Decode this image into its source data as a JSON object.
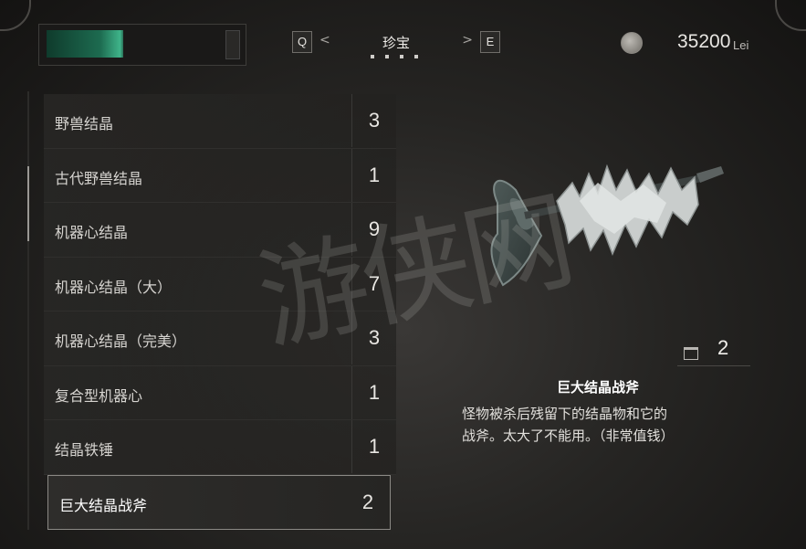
{
  "hud": {
    "health_fraction": 0.4
  },
  "nav": {
    "prev_key": "Q",
    "next_key": "E",
    "tab_label": "珍宝",
    "tab_page_count": 4
  },
  "currency": {
    "amount": "35200",
    "unit": "Lei"
  },
  "items": [
    {
      "name": "野兽结晶",
      "count": "3"
    },
    {
      "name": "古代野兽结晶",
      "count": "1"
    },
    {
      "name": "机器心结晶",
      "count": "9"
    },
    {
      "name": "机器心结晶（大）",
      "count": "7"
    },
    {
      "name": "机器心结晶（完美）",
      "count": "3"
    },
    {
      "name": "复合型机器心",
      "count": "1"
    },
    {
      "name": "结晶铁锤",
      "count": "1"
    },
    {
      "name": "巨大结晶战斧",
      "count": "2"
    }
  ],
  "selected_index": 7,
  "detail": {
    "owned_count": "2",
    "name": "巨大结晶战斧",
    "description_line1": "怪物被杀后残留下的结晶物和它的",
    "description_line2": "战斧。太大了不能用。（非常值钱）"
  },
  "icons": {
    "currency": "coin-icon",
    "owned": "inventory-case-icon",
    "item_image": "crystal-battle-axe-image"
  },
  "colors": {
    "health_accent": "#3fb48a",
    "selection_border": "#8b8985"
  },
  "watermark": "游侠网"
}
